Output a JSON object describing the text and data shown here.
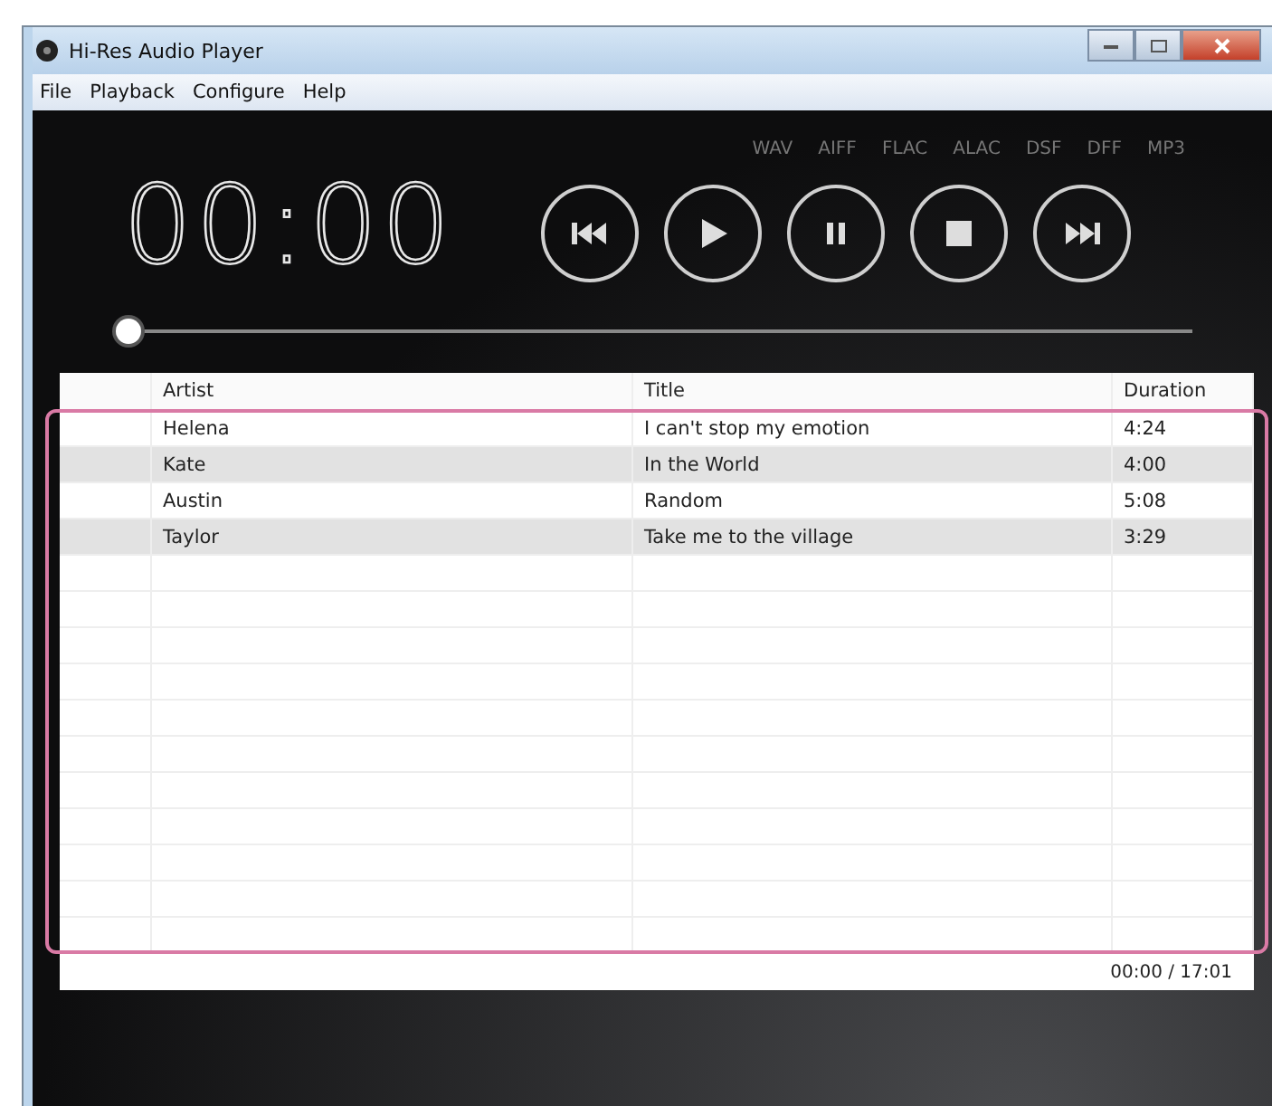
{
  "window": {
    "title": "Hi-Res Audio Player"
  },
  "menu": [
    "File",
    "Playback",
    "Configure",
    "Help"
  ],
  "formats": [
    "WAV",
    "AIFF",
    "FLAC",
    "ALAC",
    "DSF",
    "DFF",
    "MP3"
  ],
  "time": "00:00",
  "controls": [
    {
      "kind": "previous"
    },
    {
      "kind": "play"
    },
    {
      "kind": "pause"
    },
    {
      "kind": "stop"
    },
    {
      "kind": "next"
    }
  ],
  "seek": {
    "level": 0
  },
  "table": {
    "columns": [
      "Artist",
      "Title",
      "Duration"
    ],
    "rows": [
      {
        "artist": "Helena",
        "title": "I can't stop my emotion",
        "duration": "4:24"
      },
      {
        "artist": "Kate",
        "title": "In the World",
        "duration": "4:00"
      },
      {
        "artist": "Austin",
        "title": "Random",
        "duration": "5:08"
      },
      {
        "artist": "Taylor",
        "title": "Take me to the village",
        "duration": "3:29"
      }
    ]
  },
  "status": "00:00 / 17:01"
}
